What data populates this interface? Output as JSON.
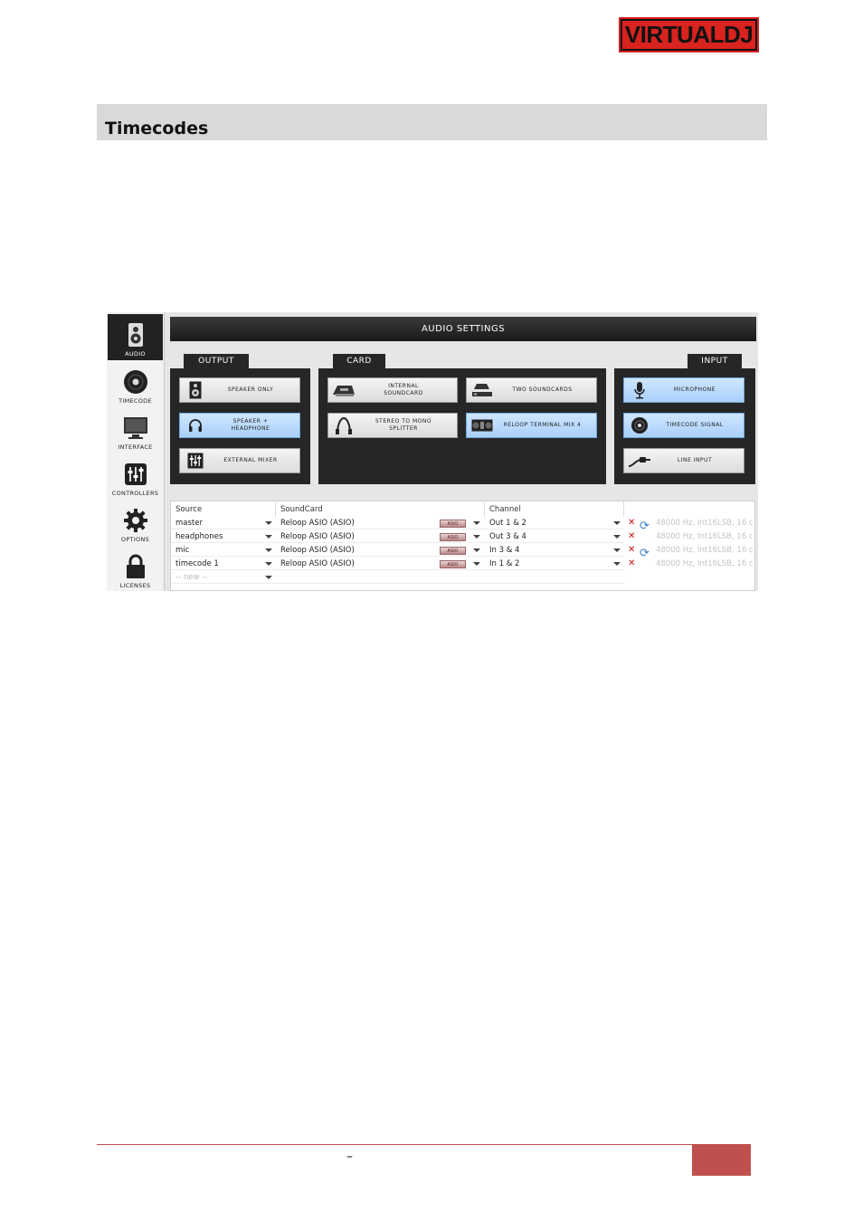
{
  "logo": {
    "text": "VIRTUALDJ",
    "color": "#d8231f"
  },
  "section": {
    "title": "Timecodes"
  },
  "sidebar": {
    "items": [
      {
        "label": "AUDIO",
        "icon": "speaker-icon",
        "active": true
      },
      {
        "label": "TIMECODE",
        "icon": "vinyl-icon"
      },
      {
        "label": "INTERFACE",
        "icon": "monitor-icon"
      },
      {
        "label": "CONTROLLERS",
        "icon": "sliders-icon"
      },
      {
        "label": "OPTIONS",
        "icon": "gear-icon"
      },
      {
        "label": "LICENSES",
        "icon": "lock-icon"
      }
    ]
  },
  "audio": {
    "title": "AUDIO SETTINGS",
    "output": {
      "tab": "OUTPUT",
      "options": [
        {
          "label": "SPEAKER ONLY",
          "icon": "speaker-icon"
        },
        {
          "label": "SPEAKER +\nHEADPHONE",
          "icon": "headphones-icon",
          "selected": true
        },
        {
          "label": "EXTERNAL MIXER",
          "icon": "mixer-icon"
        }
      ]
    },
    "card": {
      "tab": "CARD",
      "options": [
        {
          "label": "INTERNAL\nSOUNDCARD",
          "icon": "soundcard-icon"
        },
        {
          "label": "TWO SOUNDCARDS",
          "icon": "soundcards-icon"
        },
        {
          "label": "STEREO TO MONO\nSPLITTER",
          "icon": "splitter-cable-icon"
        },
        {
          "label": "RELOOP TERMINAL MIX 4",
          "icon": "controller-icon",
          "selected": true
        }
      ]
    },
    "input": {
      "tab": "INPUT",
      "options": [
        {
          "label": "MICROPHONE",
          "icon": "microphone-icon",
          "selected": true
        },
        {
          "label": "TIMECODE SIGNAL",
          "icon": "timecode-vinyl-icon",
          "selected": true
        },
        {
          "label": "LINE INPUT",
          "icon": "line-cable-icon"
        }
      ]
    },
    "table": {
      "headers": [
        "Source",
        "SoundCard",
        "Channel"
      ],
      "asio_label": "ASIO",
      "rows": [
        {
          "source": "master",
          "soundcard": "Reloop ASIO (ASIO)",
          "channel": "Out 1 & 2",
          "info": "48000 Hz, Int16LSB, 16 c"
        },
        {
          "source": "headphones",
          "soundcard": "Reloop ASIO (ASIO)",
          "channel": "Out 3 & 4",
          "info": "48000 Hz, Int16LSB, 16 c"
        },
        {
          "source": "mic",
          "soundcard": "Reloop ASIO (ASIO)",
          "channel": "In 3 & 4",
          "info": "48000 Hz, Int16LSB, 16 c"
        },
        {
          "source": "timecode 1",
          "soundcard": "Reloop ASIO (ASIO)",
          "channel": "In 1 & 2",
          "info": "48000 Hz, Int16LSB, 16 c"
        }
      ],
      "new_row": "-- new --"
    }
  },
  "footer": {
    "dash": "–",
    "accent": "#c0504d"
  }
}
